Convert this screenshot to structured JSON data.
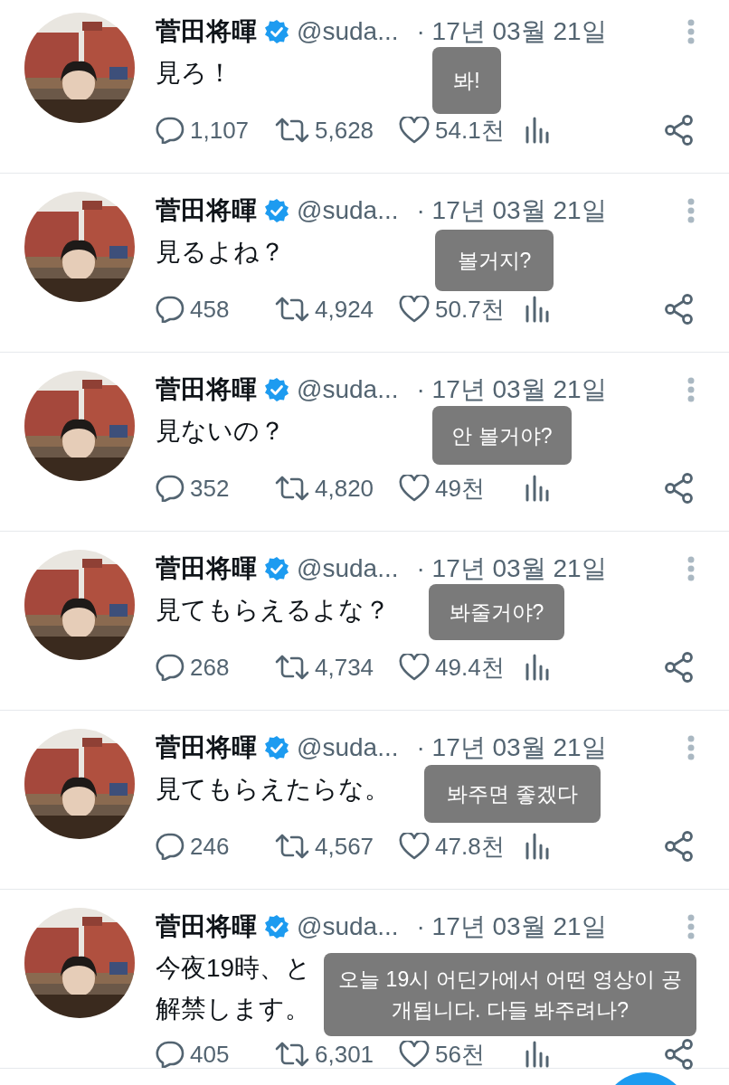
{
  "tweets": [
    {
      "name": "菅田将暉",
      "verified": true,
      "handle": "@suda...",
      "date": "· 17년 03월 21일",
      "text": [
        "見ろ！"
      ],
      "replies": "1,107",
      "retweets": "5,628",
      "likes": "54.1천",
      "translation": "봐!"
    },
    {
      "name": "菅田将暉",
      "verified": true,
      "handle": "@suda...",
      "date": "· 17년 03월 21일",
      "text": [
        "見るよね？"
      ],
      "replies": "458",
      "retweets": "4,924",
      "likes": "50.7천",
      "translation": "볼거지?"
    },
    {
      "name": "菅田将暉",
      "verified": true,
      "handle": "@suda...",
      "date": "· 17년 03월 21일",
      "text": [
        "見ないの？"
      ],
      "replies": "352",
      "retweets": "4,820",
      "likes": "49천",
      "translation": "안 볼거야?"
    },
    {
      "name": "菅田将暉",
      "verified": true,
      "handle": "@suda...",
      "date": "· 17년 03월 21일",
      "text": [
        "見てもらえるよな？"
      ],
      "replies": "268",
      "retweets": "4,734",
      "likes": "49.4천",
      "translation": "봐줄거야?"
    },
    {
      "name": "菅田将暉",
      "verified": true,
      "handle": "@suda...",
      "date": "· 17년 03월 21일",
      "text": [
        "見てもらえたらな。"
      ],
      "replies": "246",
      "retweets": "4,567",
      "likes": "47.8천",
      "translation": "봐주면 좋겠다"
    },
    {
      "name": "菅田将暉",
      "verified": true,
      "handle": "@suda...",
      "date": "· 17년 03월 21일",
      "text": [
        "今夜19時、と",
        "解禁します。"
      ],
      "replies": "405",
      "retweets": "6,301",
      "likes": "56천",
      "translation": "오늘 19시 어딘가에서 어떤 영상이 공개됩니다. 다들 봐주려나?"
    }
  ]
}
